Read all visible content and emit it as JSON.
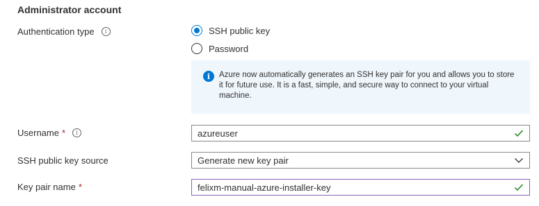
{
  "section": {
    "title": "Administrator account"
  },
  "auth": {
    "label": "Authentication type",
    "options": [
      {
        "label": "SSH public key",
        "checked": true
      },
      {
        "label": "Password",
        "checked": false
      }
    ],
    "info_text": "Azure now automatically generates an SSH key pair for you and allows you to store it for future use. It is a fast, simple, and secure way to connect to your virtual machine."
  },
  "username": {
    "label": "Username",
    "required_mark": "*",
    "value": "azureuser",
    "valid_icon": "checkmark-icon"
  },
  "key_source": {
    "label": "SSH public key source",
    "value": "Generate new key pair",
    "icon": "chevron-down-icon"
  },
  "key_name": {
    "label": "Key pair name",
    "required_mark": "*",
    "value": "felixm-manual-azure-installer-key",
    "valid_icon": "checkmark-icon"
  },
  "colors": {
    "accent": "#0078d4",
    "valid": "#107c10",
    "focus_border": "#8764b8",
    "info_bg": "#eff6fc",
    "required": "#a4262c"
  }
}
